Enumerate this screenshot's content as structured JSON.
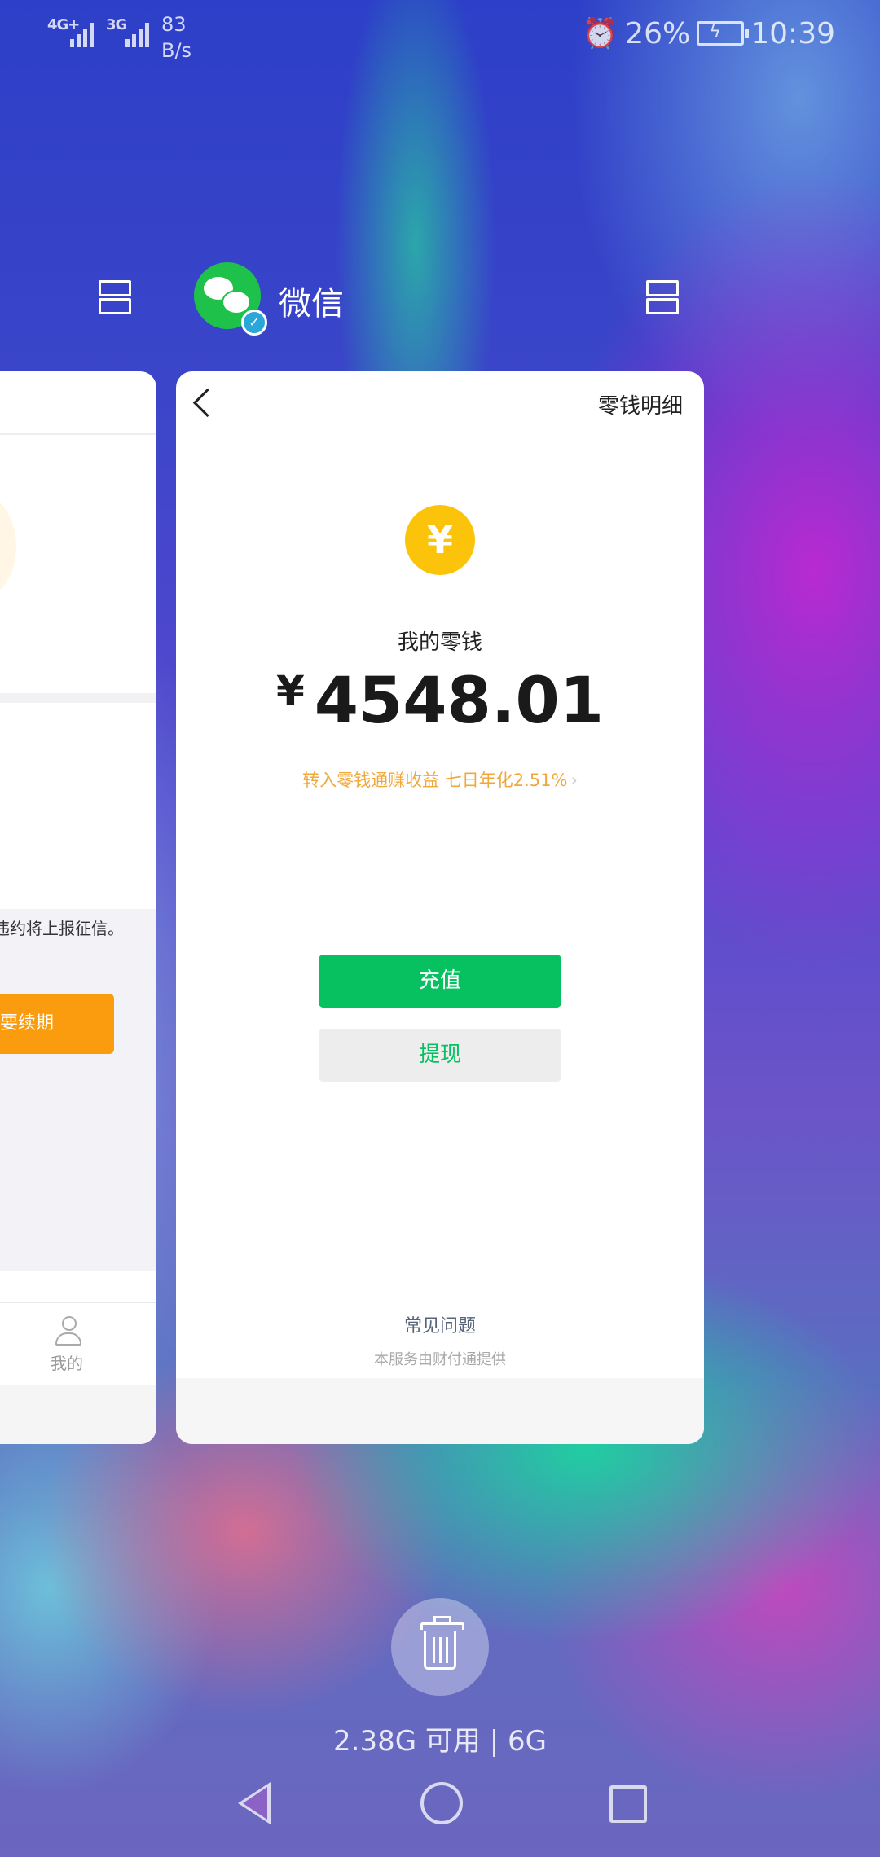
{
  "status_bar": {
    "sim1": "4G+",
    "sim2": "3G",
    "net_speed_value": "83",
    "net_speed_unit": "B/s",
    "battery": "26%",
    "time": "10:39"
  },
  "recents": {
    "app_name": "微信",
    "memory": "2.38G 可用 | 6G"
  },
  "left_card": {
    "text": "违约将上报征信。",
    "button": "要续期",
    "tab_label": "我的"
  },
  "wallet": {
    "detail_link": "零钱明细",
    "coin_symbol": "¥",
    "balance_label": "我的零钱",
    "currency": "¥",
    "amount": "4548.01",
    "promo": "转入零钱通赚收益 七日年化2.51%",
    "promo_chevron": "›",
    "recharge": "充值",
    "withdraw": "提现",
    "faq": "常见问题",
    "provider": "本服务由财付通提供"
  },
  "colors": {
    "wechat_green": "#07c160",
    "coin_yellow": "#fbc40a",
    "promo_orange": "#f0a83a",
    "left_button_orange": "#fa9c0e"
  }
}
